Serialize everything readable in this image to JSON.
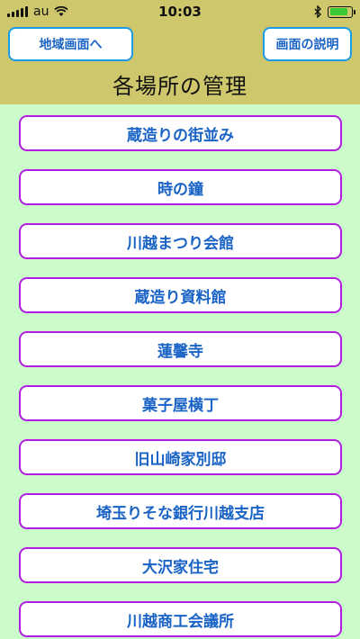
{
  "status_bar": {
    "carrier": "au",
    "time": "10:03",
    "battery_level": 0.85
  },
  "header": {
    "back_button": "地域画面へ",
    "help_button": "画面の説明",
    "title": "各場所の管理"
  },
  "places": [
    "蔵造りの街並み",
    "時の鐘",
    "川越まつり会館",
    "蔵造り資料館",
    "蓮馨寺",
    "菓子屋横丁",
    "旧山崎家別邸",
    "埼玉りそな銀行川越支店",
    "大沢家住宅",
    "川越商工会議所"
  ],
  "colors": {
    "header_bg": "#cfc76b",
    "list_bg": "#cbfbcb",
    "item_border": "#b31ce0",
    "item_text": "#1a63c6",
    "header_button_border": "#1c9be8"
  }
}
